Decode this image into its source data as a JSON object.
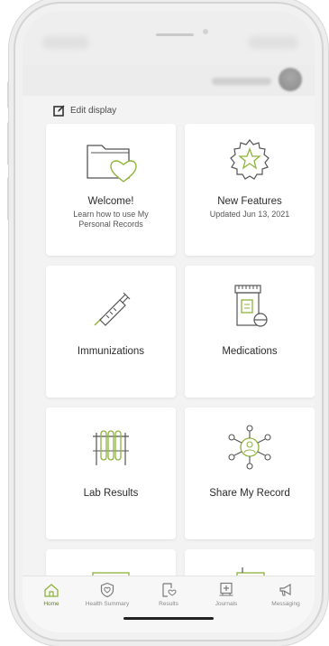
{
  "edit_display": {
    "label": "Edit display",
    "icon": "edit-icon"
  },
  "tiles": [
    {
      "title": "Welcome!",
      "subtitle": "Learn how to use My Personal Records",
      "icon": "folder-heart-icon"
    },
    {
      "title": "New Features",
      "subtitle": "Updated Jun 13, 2021",
      "icon": "star-badge-icon"
    },
    {
      "title": "Immunizations",
      "subtitle": "",
      "icon": "syringe-icon"
    },
    {
      "title": "Medications",
      "subtitle": "",
      "icon": "pill-bottle-icon"
    },
    {
      "title": "Lab Results",
      "subtitle": "",
      "icon": "test-tubes-icon"
    },
    {
      "title": "Share My Record",
      "subtitle": "",
      "icon": "share-network-icon"
    }
  ],
  "nav": [
    {
      "label": "Home",
      "icon": "home-icon",
      "active": true
    },
    {
      "label": "Health Summary",
      "icon": "shield-heart-icon",
      "active": false
    },
    {
      "label": "Results",
      "icon": "results-icon",
      "active": false
    },
    {
      "label": "Journals",
      "icon": "journal-icon",
      "active": false
    },
    {
      "label": "Messaging",
      "icon": "megaphone-icon",
      "active": false
    }
  ],
  "colors": {
    "accent": "#8db33b",
    "icon_stroke": "#555555",
    "active_nav": "#5f7f23"
  }
}
